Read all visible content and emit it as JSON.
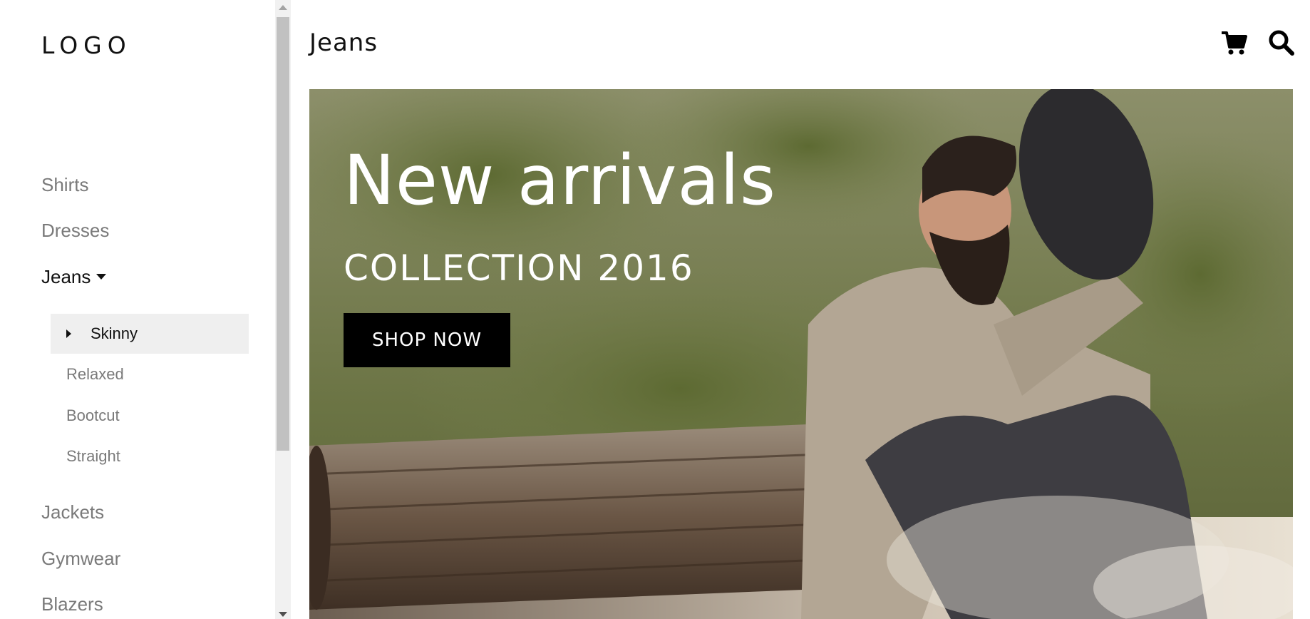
{
  "sidebar": {
    "logo": "LOGO",
    "items": [
      {
        "label": "Shirts"
      },
      {
        "label": "Dresses"
      },
      {
        "label": "Jeans",
        "expanded": true
      },
      {
        "label": "Jackets"
      },
      {
        "label": "Gymwear"
      },
      {
        "label": "Blazers"
      }
    ],
    "sub_items": [
      {
        "label": "Skinny",
        "selected": true
      },
      {
        "label": "Relaxed"
      },
      {
        "label": "Bootcut"
      },
      {
        "label": "Straight"
      }
    ]
  },
  "header": {
    "title": "Jeans",
    "icons": [
      "cart-icon",
      "search-icon"
    ]
  },
  "hero": {
    "title": "New arrivals",
    "subtitle": "COLLECTION 2016",
    "button_label": "SHOP NOW"
  },
  "colors": {
    "text_dark": "#111111",
    "text_muted": "#7a7a7a",
    "selected_bg": "#efefef",
    "button_bg": "#000000",
    "button_text": "#ffffff"
  }
}
